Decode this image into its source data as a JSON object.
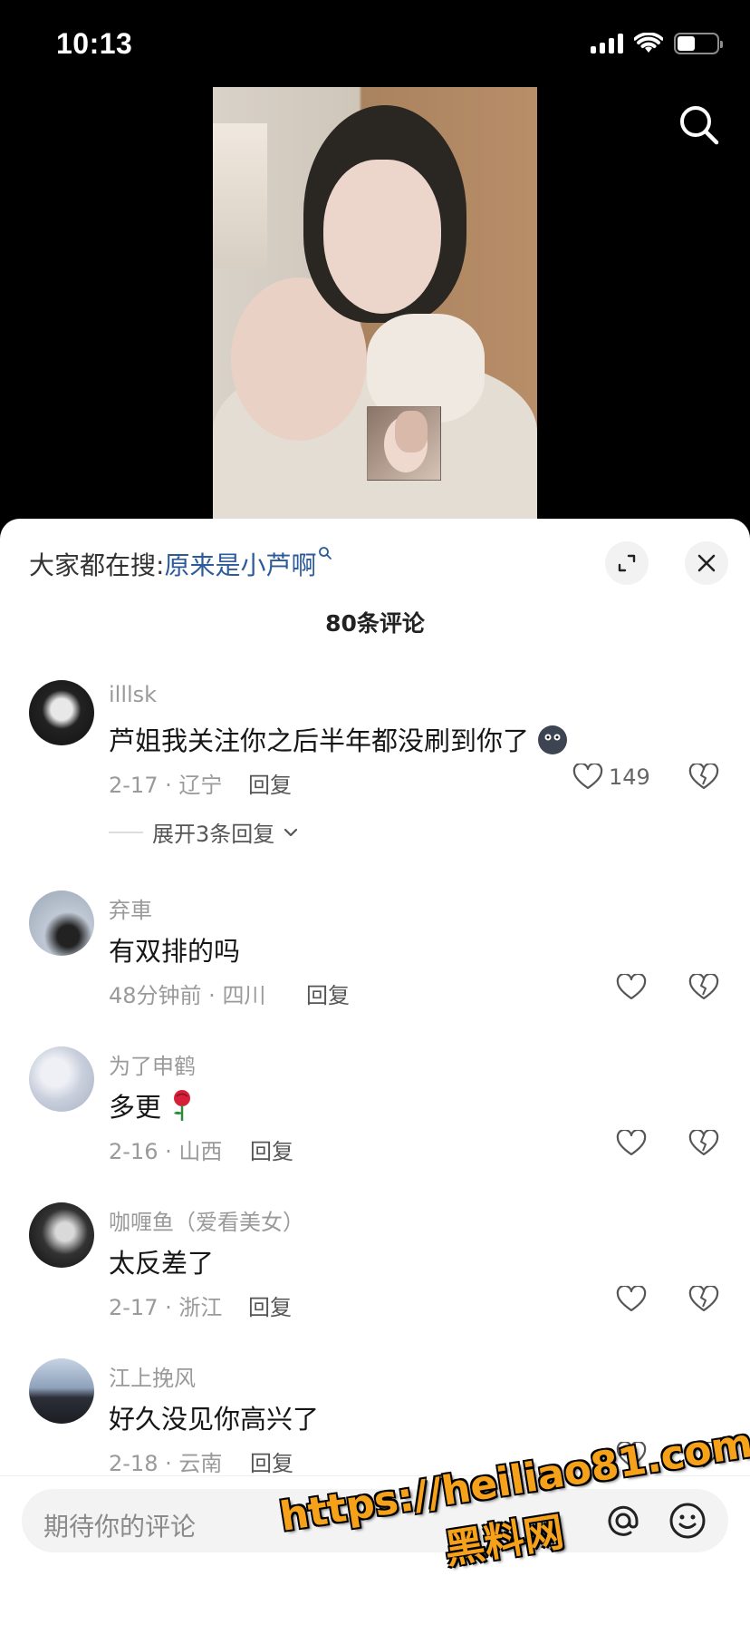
{
  "status_bar": {
    "time": "10:13"
  },
  "search_suggest": {
    "prefix": "大家都在搜:",
    "keyword": "原来是小芦啊"
  },
  "comments_header": {
    "count_label": "80条评论"
  },
  "comments": [
    {
      "user": "illlsk",
      "text": "芦姐我关注你之后半年都没刷到你了",
      "emoji": "blob-face",
      "date": "2-17",
      "location": "辽宁",
      "reply_label": "回复",
      "likes": "149",
      "expand_label": "展开3条回复"
    },
    {
      "user": "弃車",
      "text": "有双排的吗",
      "date": "48分钟前",
      "location": "四川",
      "reply_label": "回复",
      "likes": ""
    },
    {
      "user": "为了申鹤",
      "text": "多更",
      "emoji": "rose",
      "date": "2-16",
      "location": "山西",
      "reply_label": "回复",
      "likes": ""
    },
    {
      "user": "咖喱鱼（爱看美女）",
      "text": "太反差了",
      "date": "2-17",
      "location": "浙江",
      "reply_label": "回复",
      "likes": ""
    },
    {
      "user": "江上挽风",
      "text": "好久没见你高兴了",
      "date": "2-18",
      "location": "云南",
      "reply_label": "回复",
      "likes": ""
    }
  ],
  "input": {
    "placeholder": "期待你的评论"
  },
  "watermark": {
    "url": "https://heiliao81.com",
    "name": "黑料网"
  },
  "colors": {
    "keyword": "#2b5b9a",
    "watermark": "#f6a11a"
  }
}
